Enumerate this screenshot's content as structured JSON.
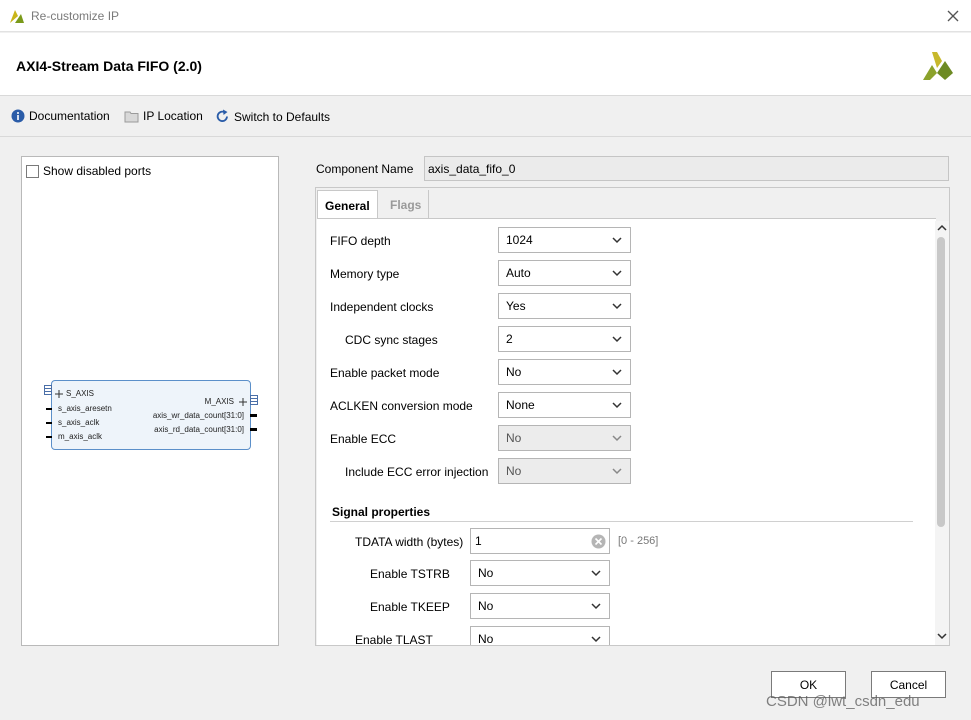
{
  "window": {
    "title": "Re-customize IP"
  },
  "header": {
    "ip_title": "AXI4-Stream Data FIFO (2.0)"
  },
  "toolbar": {
    "documentation": "Documentation",
    "ip_location": "IP Location",
    "switch_defaults": "Switch to Defaults"
  },
  "left_panel": {
    "show_disabled_ports": "Show disabled ports",
    "block": {
      "left_ports": [
        "S_AXIS",
        "s_axis_aresetn",
        "s_axis_aclk",
        "m_axis_aclk"
      ],
      "right_ports": [
        "M_AXIS",
        "axis_wr_data_count[31:0]",
        "axis_rd_data_count[31:0]"
      ]
    }
  },
  "component": {
    "label": "Component Name",
    "value": "axis_data_fifo_0"
  },
  "tabs": [
    "General",
    "Flags"
  ],
  "general": {
    "fields": [
      {
        "label": "FIFO depth",
        "value": "1024"
      },
      {
        "label": "Memory type",
        "value": "Auto"
      },
      {
        "label": "Independent clocks",
        "value": "Yes"
      },
      {
        "label": "CDC sync stages",
        "value": "2"
      },
      {
        "label": "Enable packet mode",
        "value": "No"
      },
      {
        "label": "ACLKEN conversion mode",
        "value": "None"
      },
      {
        "label": "Enable ECC",
        "value": "No"
      },
      {
        "label": "Include ECC error injection",
        "value": "No"
      }
    ],
    "signal_properties": {
      "title": "Signal properties",
      "tdata": {
        "label": "TDATA width (bytes)",
        "value": "1",
        "range": "[0 - 256]"
      },
      "fields": [
        {
          "label": "Enable TSTRB",
          "value": "No"
        },
        {
          "label": "Enable TKEEP",
          "value": "No"
        },
        {
          "label": "Enable TLAST",
          "value": "No"
        }
      ]
    }
  },
  "footer": {
    "ok": "OK",
    "cancel": "Cancel"
  },
  "watermark": "CSDN @lwt_csdn_edu"
}
